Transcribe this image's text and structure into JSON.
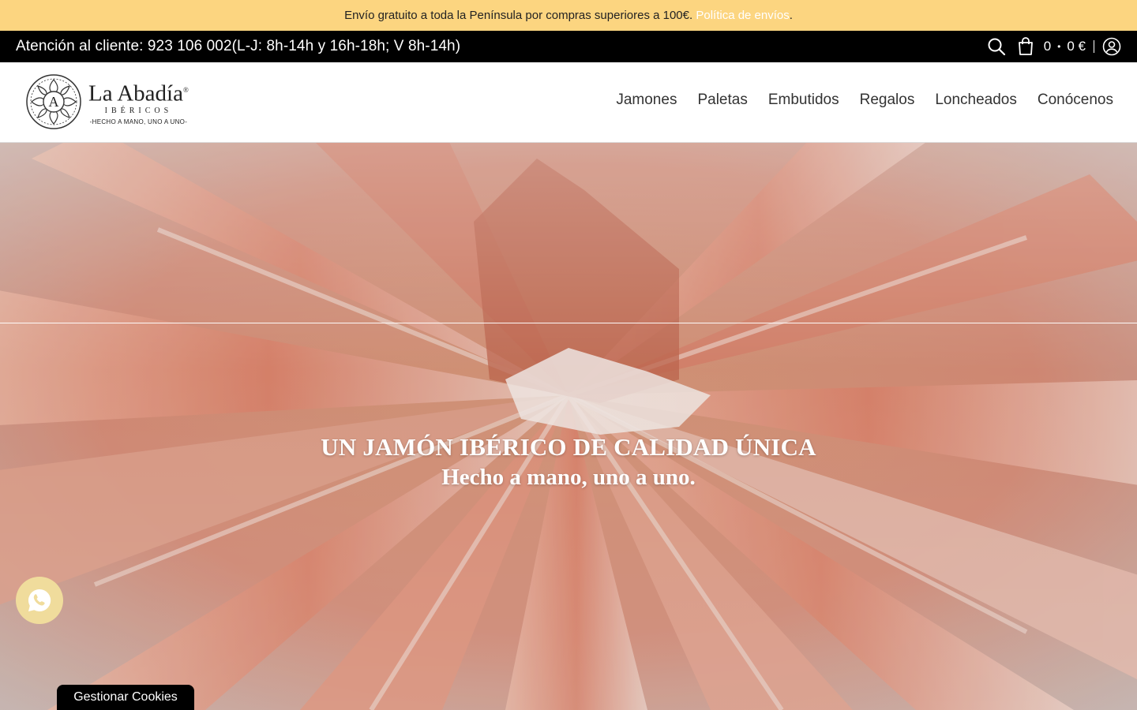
{
  "announcement": {
    "text": "Envío gratuito a toda la Península por compras superiores a 100€.",
    "link": "Política de envíos",
    "trail": "."
  },
  "utility_bar": {
    "contact": "Atención al cliente: 923 106 002(L-J: 8h-14h y 16h-18h; V 8h-14h)",
    "cart_count": "0",
    "cart_separator": "•",
    "cart_total": "0 €",
    "icons": [
      "search-icon",
      "cart-icon",
      "account-icon"
    ]
  },
  "header": {
    "logo": {
      "name": "La Abadía",
      "mark": "®",
      "subtitle": "IBÉRICOS",
      "tagline": "-HECHO A MANO, UNO A UNO-",
      "emblem_letter": "A"
    },
    "nav": [
      "Jamones",
      "Paletas",
      "Embutidos",
      "Regalos",
      "Loncheados",
      "Conócenos"
    ]
  },
  "hero": {
    "title": "UN JAMÓN IBÉRICO DE CALIDAD ÚNICA",
    "subtitle": "Hecho a mano, uno a uno."
  },
  "floating": {
    "whatsapp_icon": "whatsapp-icon",
    "cookies_label": "Gestionar Cookies"
  },
  "colors": {
    "announcement_bg": "#fcd580",
    "utility_bg": "#000000",
    "whatsapp_bg": "#f0dc9c"
  }
}
